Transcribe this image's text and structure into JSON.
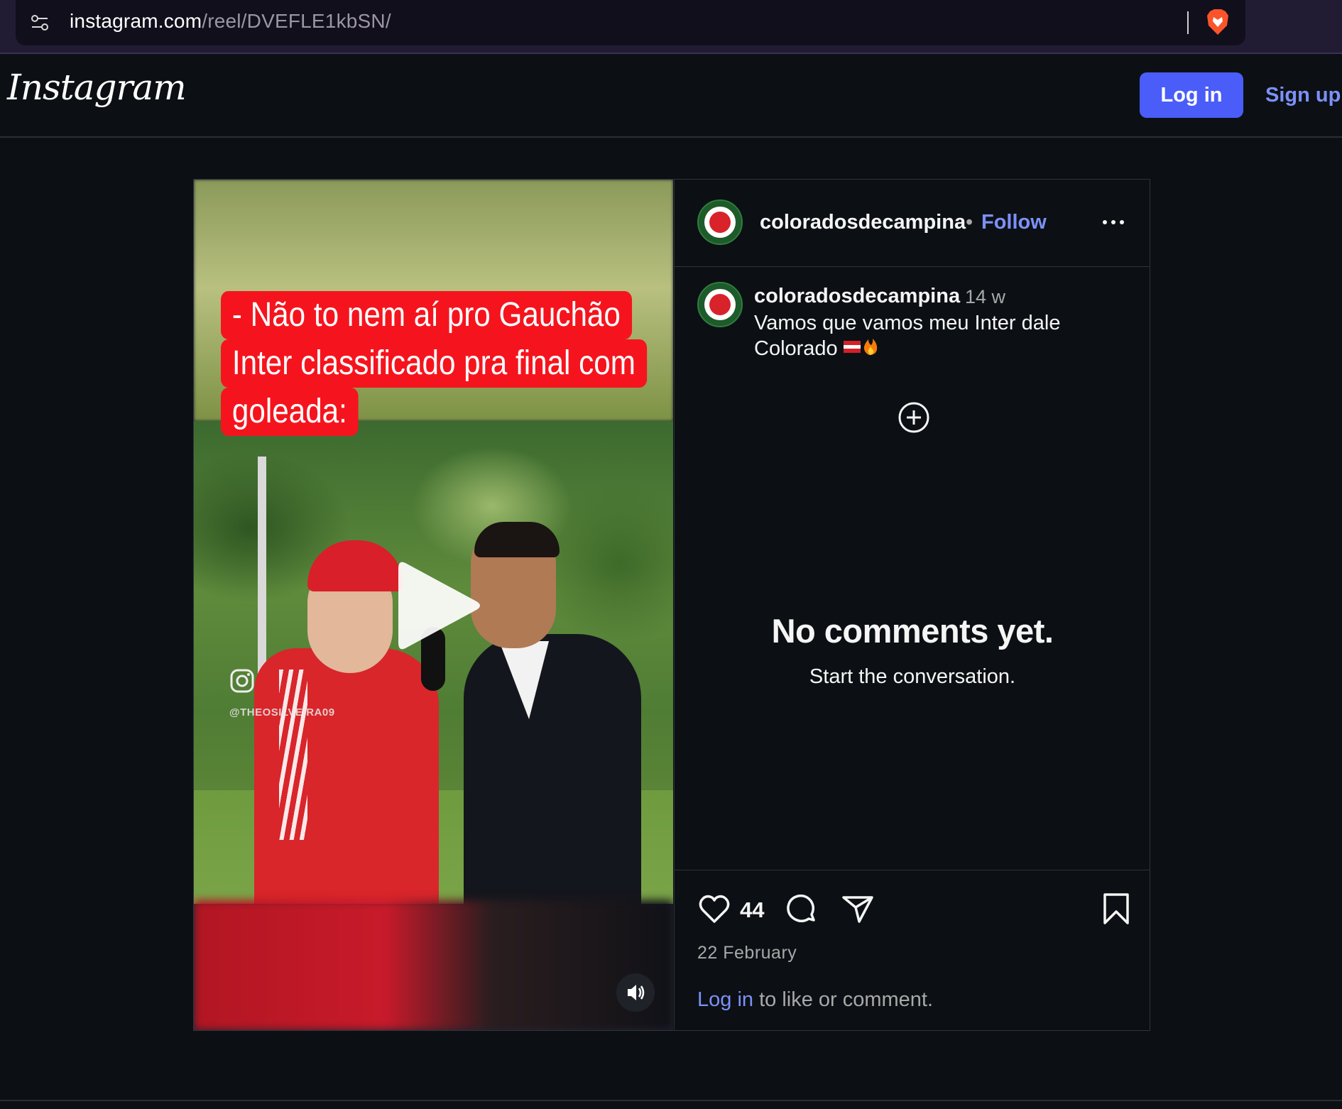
{
  "browser": {
    "url_host": "instagram.com",
    "url_path": "/reel/DVEFLE1kbSN/"
  },
  "header": {
    "logo": "Instagram",
    "login_label": "Log in",
    "signup_label": "Sign up",
    "accent_color": "#4a5df9"
  },
  "post": {
    "video_caption_lines": [
      "- Não to nem aí pro Gauchão",
      "Inter classificado pra final com",
      "goleada:"
    ],
    "watermark": "@THEOSILVEIRA09",
    "author": "coloradosdecampina",
    "separator": "•",
    "follow_label": "Follow",
    "comment": {
      "author": "coloradosdecampina",
      "time": "14 w",
      "text": "Vamos que vamos meu Inter dale Colorado"
    },
    "empty_title": "No comments yet.",
    "empty_subtitle": "Start the conversation.",
    "likes": "44",
    "date": "22 February",
    "login_link": "Log in",
    "login_suffix": "to like or comment."
  },
  "icons": [
    "site-settings-icon",
    "brave-icon",
    "more-options-icon",
    "add-comment-icon",
    "heart-icon",
    "comment-icon",
    "share-icon",
    "bookmark-icon",
    "play-icon",
    "speaker-icon",
    "instagram-icon"
  ]
}
